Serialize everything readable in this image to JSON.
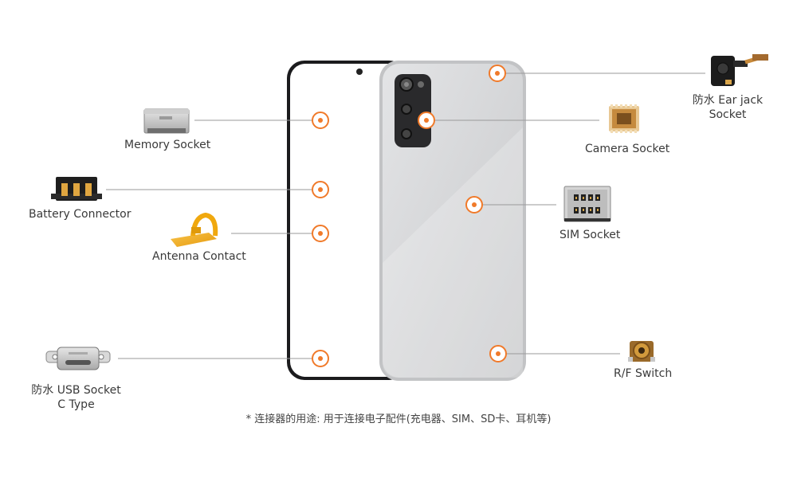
{
  "components": {
    "memory_socket": {
      "label": "Memory Socket"
    },
    "battery_connector": {
      "label": "Battery Connector"
    },
    "antenna_contact": {
      "label": "Antenna Contact"
    },
    "usb_socket": {
      "line1": "防水 USB Socket",
      "line2": "C Type"
    },
    "ear_jack": {
      "line1": "防水 Ear jack",
      "line2": "Socket"
    },
    "camera_socket": {
      "label": "Camera Socket"
    },
    "sim_socket": {
      "label": "SIM Socket"
    },
    "rf_switch": {
      "label": "R/F Switch"
    }
  },
  "footnote": "* 连接器的用途: 用于连接电子配件(充电器、SIM、SD卡、耳机等)",
  "colors": {
    "marker": "#f07a2a",
    "leader_line": "#9a9a9a",
    "phone_back": "#d3d4d6",
    "antenna_gold": "#f2a814"
  }
}
